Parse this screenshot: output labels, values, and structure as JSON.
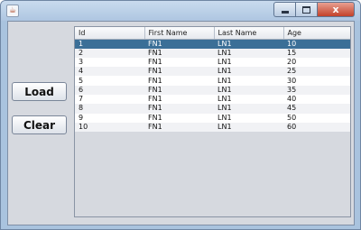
{
  "window": {
    "title": "",
    "close_glyph": "x",
    "colors": {
      "selection": "#3b6f97",
      "client_bg": "#d6d9df",
      "frame": "#a9c3de"
    }
  },
  "buttons": {
    "load": "Load",
    "clear": "Clear"
  },
  "table": {
    "columns": [
      "Id",
      "First Name",
      "Last Name",
      "Age"
    ],
    "selected_row": 0,
    "rows": [
      [
        "1",
        "FN1",
        "LN1",
        "10"
      ],
      [
        "2",
        "FN1",
        "LN1",
        "15"
      ],
      [
        "3",
        "FN1",
        "LN1",
        "20"
      ],
      [
        "4",
        "FN1",
        "LN1",
        "25"
      ],
      [
        "5",
        "FN1",
        "LN1",
        "30"
      ],
      [
        "6",
        "FN1",
        "LN1",
        "35"
      ],
      [
        "7",
        "FN1",
        "LN1",
        "40"
      ],
      [
        "8",
        "FN1",
        "LN1",
        "45"
      ],
      [
        "9",
        "FN1",
        "LN1",
        "50"
      ],
      [
        "10",
        "FN1",
        "LN1",
        "60"
      ]
    ]
  }
}
